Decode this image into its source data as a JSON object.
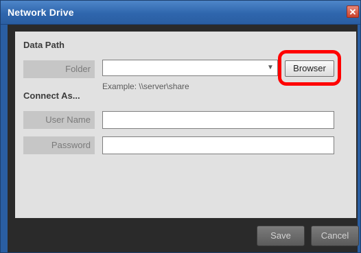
{
  "window": {
    "title": "Network Drive",
    "close_glyph": "✕"
  },
  "data_path": {
    "section_title": "Data Path",
    "folder_label": "Folder",
    "folder_value": "",
    "dropdown_arrow": "▼",
    "example_text": "Example: \\\\server\\share",
    "browse_label": "Browser"
  },
  "connect_as": {
    "section_title": "Connect As...",
    "username_label": "User Name",
    "username_value": "",
    "password_label": "Password",
    "password_value": ""
  },
  "footer": {
    "save_label": "Save",
    "cancel_label": "Cancel"
  },
  "colors": {
    "highlight": "#ff0000",
    "title_bar": "#2f66ad",
    "content_bg": "#e1e1e1"
  }
}
